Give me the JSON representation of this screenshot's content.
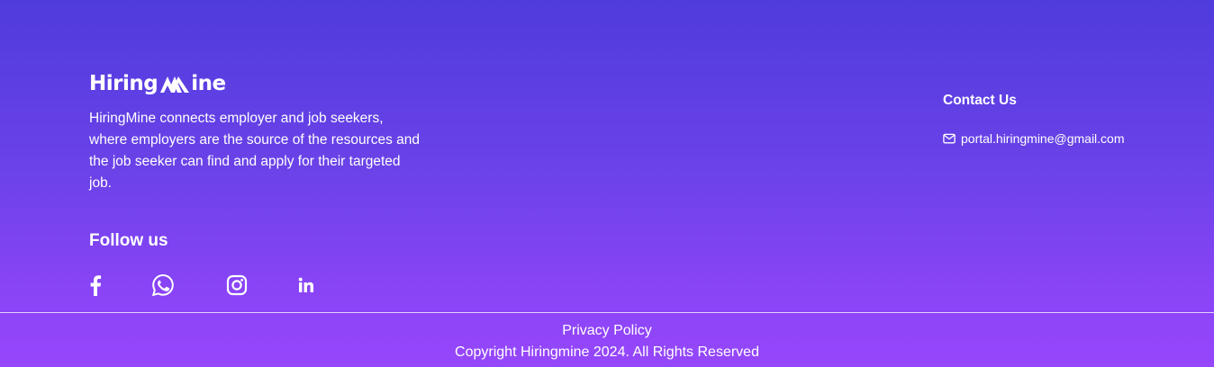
{
  "brand": {
    "logo_part1": "Hiring",
    "logo_part2": "ine",
    "description": "HiringMine connects employer and job seekers, where employers are the source of the resources and the job seeker can find and apply for their targeted job."
  },
  "follow": {
    "title": "Follow us",
    "icons": [
      "facebook-icon",
      "whatsapp-icon",
      "instagram-icon",
      "linkedin-icon"
    ]
  },
  "contact": {
    "title": "Contact Us",
    "email": "portal.hiringmine@gmail.com",
    "icon": "mail-icon"
  },
  "bottom": {
    "privacy_label": "Privacy Policy",
    "copyright": "Copyright Hiringmine 2024. All Rights Reserved"
  },
  "colors": {
    "gradient_top": "#4f3bdc",
    "gradient_bottom": "#9646fb",
    "text": "#ffffff"
  }
}
